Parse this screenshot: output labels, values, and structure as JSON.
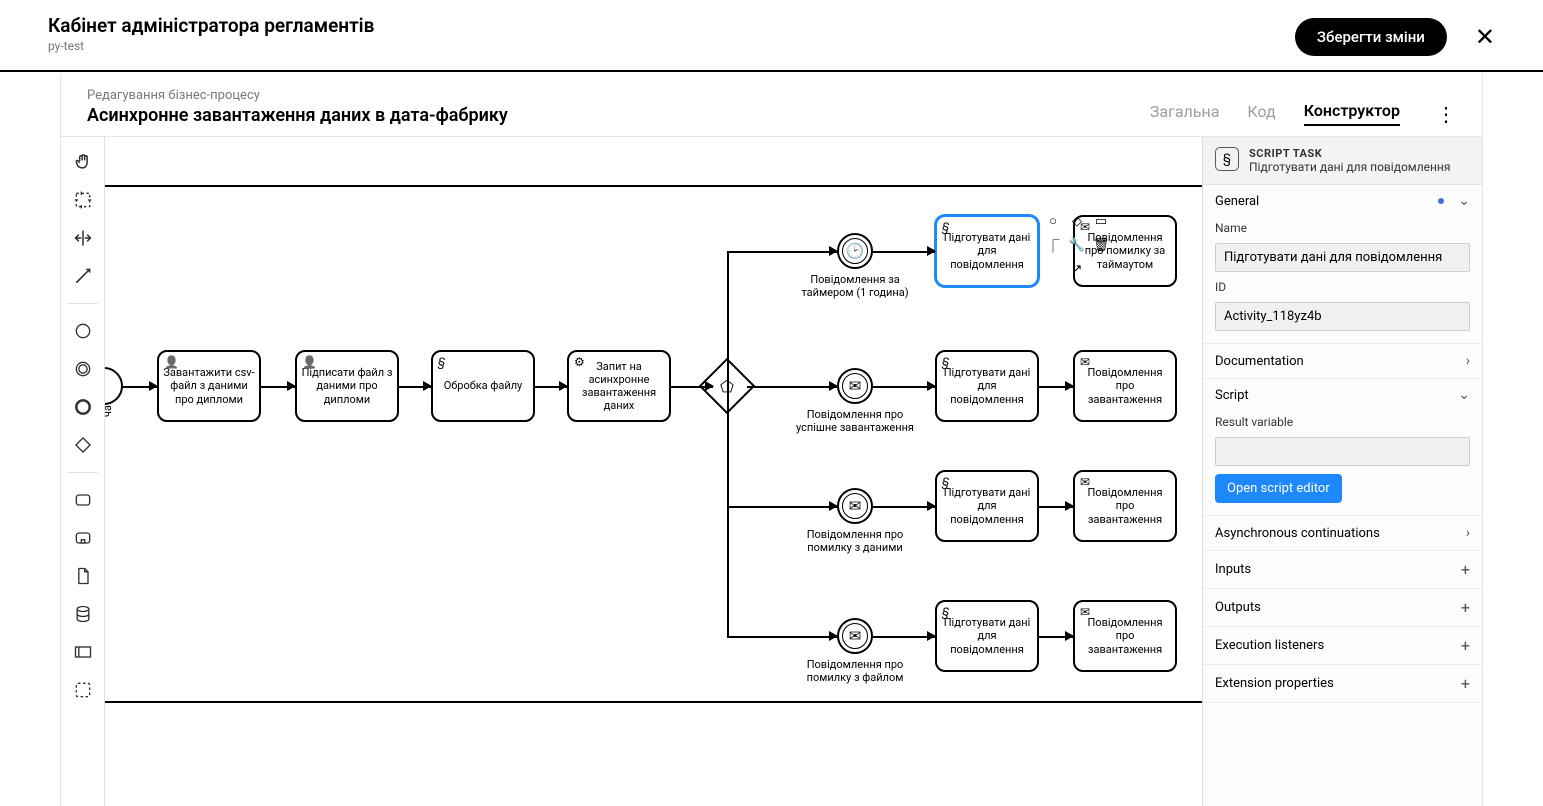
{
  "header": {
    "app_title": "Кабінет адміністратора регламентів",
    "project": "py-test",
    "save_btn": "Зберегти зміни"
  },
  "subheader": {
    "crumb": "Редагування бізнес-процесу",
    "title": "Асинхронне завантаження даних в дата-фабрику",
    "tabs": {
      "general": "Загальна",
      "code": "Код",
      "builder": "Конструктор"
    }
  },
  "canvas": {
    "lane_label": "чато",
    "tasks": {
      "t1": "Завантажити csv-файл з даними про дипломи",
      "t2": "Підписати файл з даними про дипломи",
      "t3": "Обробка файлу",
      "t4": "Запит на асинхронне завантаження даних",
      "prep1": "Підготувати дані для повідомлення",
      "notify_timeout": "Повідомлення про помилку за таймаутом",
      "prep2": "Підготувати дані для повідомлення",
      "notify_ok": "Повідомлення про завантаження",
      "prep3": "Підготувати дані для повідомлення",
      "notify_data_err": "Повідомлення про завантаження",
      "prep4": "Підготувати дані для повідомлення",
      "notify_file_err": "Повідомлення про завантаження"
    },
    "events": {
      "timer": "Повідомлення за таймером (1 година)",
      "ok": "Повідомлення про успішне завантаження",
      "data_err": "Повідомлення про помилку з даними",
      "file_err": "Повідомлення про помилку з файлом"
    }
  },
  "props": {
    "type_label": "SCRIPT TASK",
    "node_name": "Підготувати дані для повідомлення",
    "sections": {
      "general": "General",
      "name_label": "Name",
      "name_value": "Підготувати дані для повідомлення",
      "id_label": "ID",
      "id_value": "Activity_118yz4b",
      "documentation": "Documentation",
      "script": "Script",
      "result_var": "Result variable",
      "open_editor": "Open script editor",
      "async": "Asynchronous continuations",
      "inputs": "Inputs",
      "outputs": "Outputs",
      "exec_listeners": "Execution listeners",
      "ext_props": "Extension properties"
    }
  }
}
